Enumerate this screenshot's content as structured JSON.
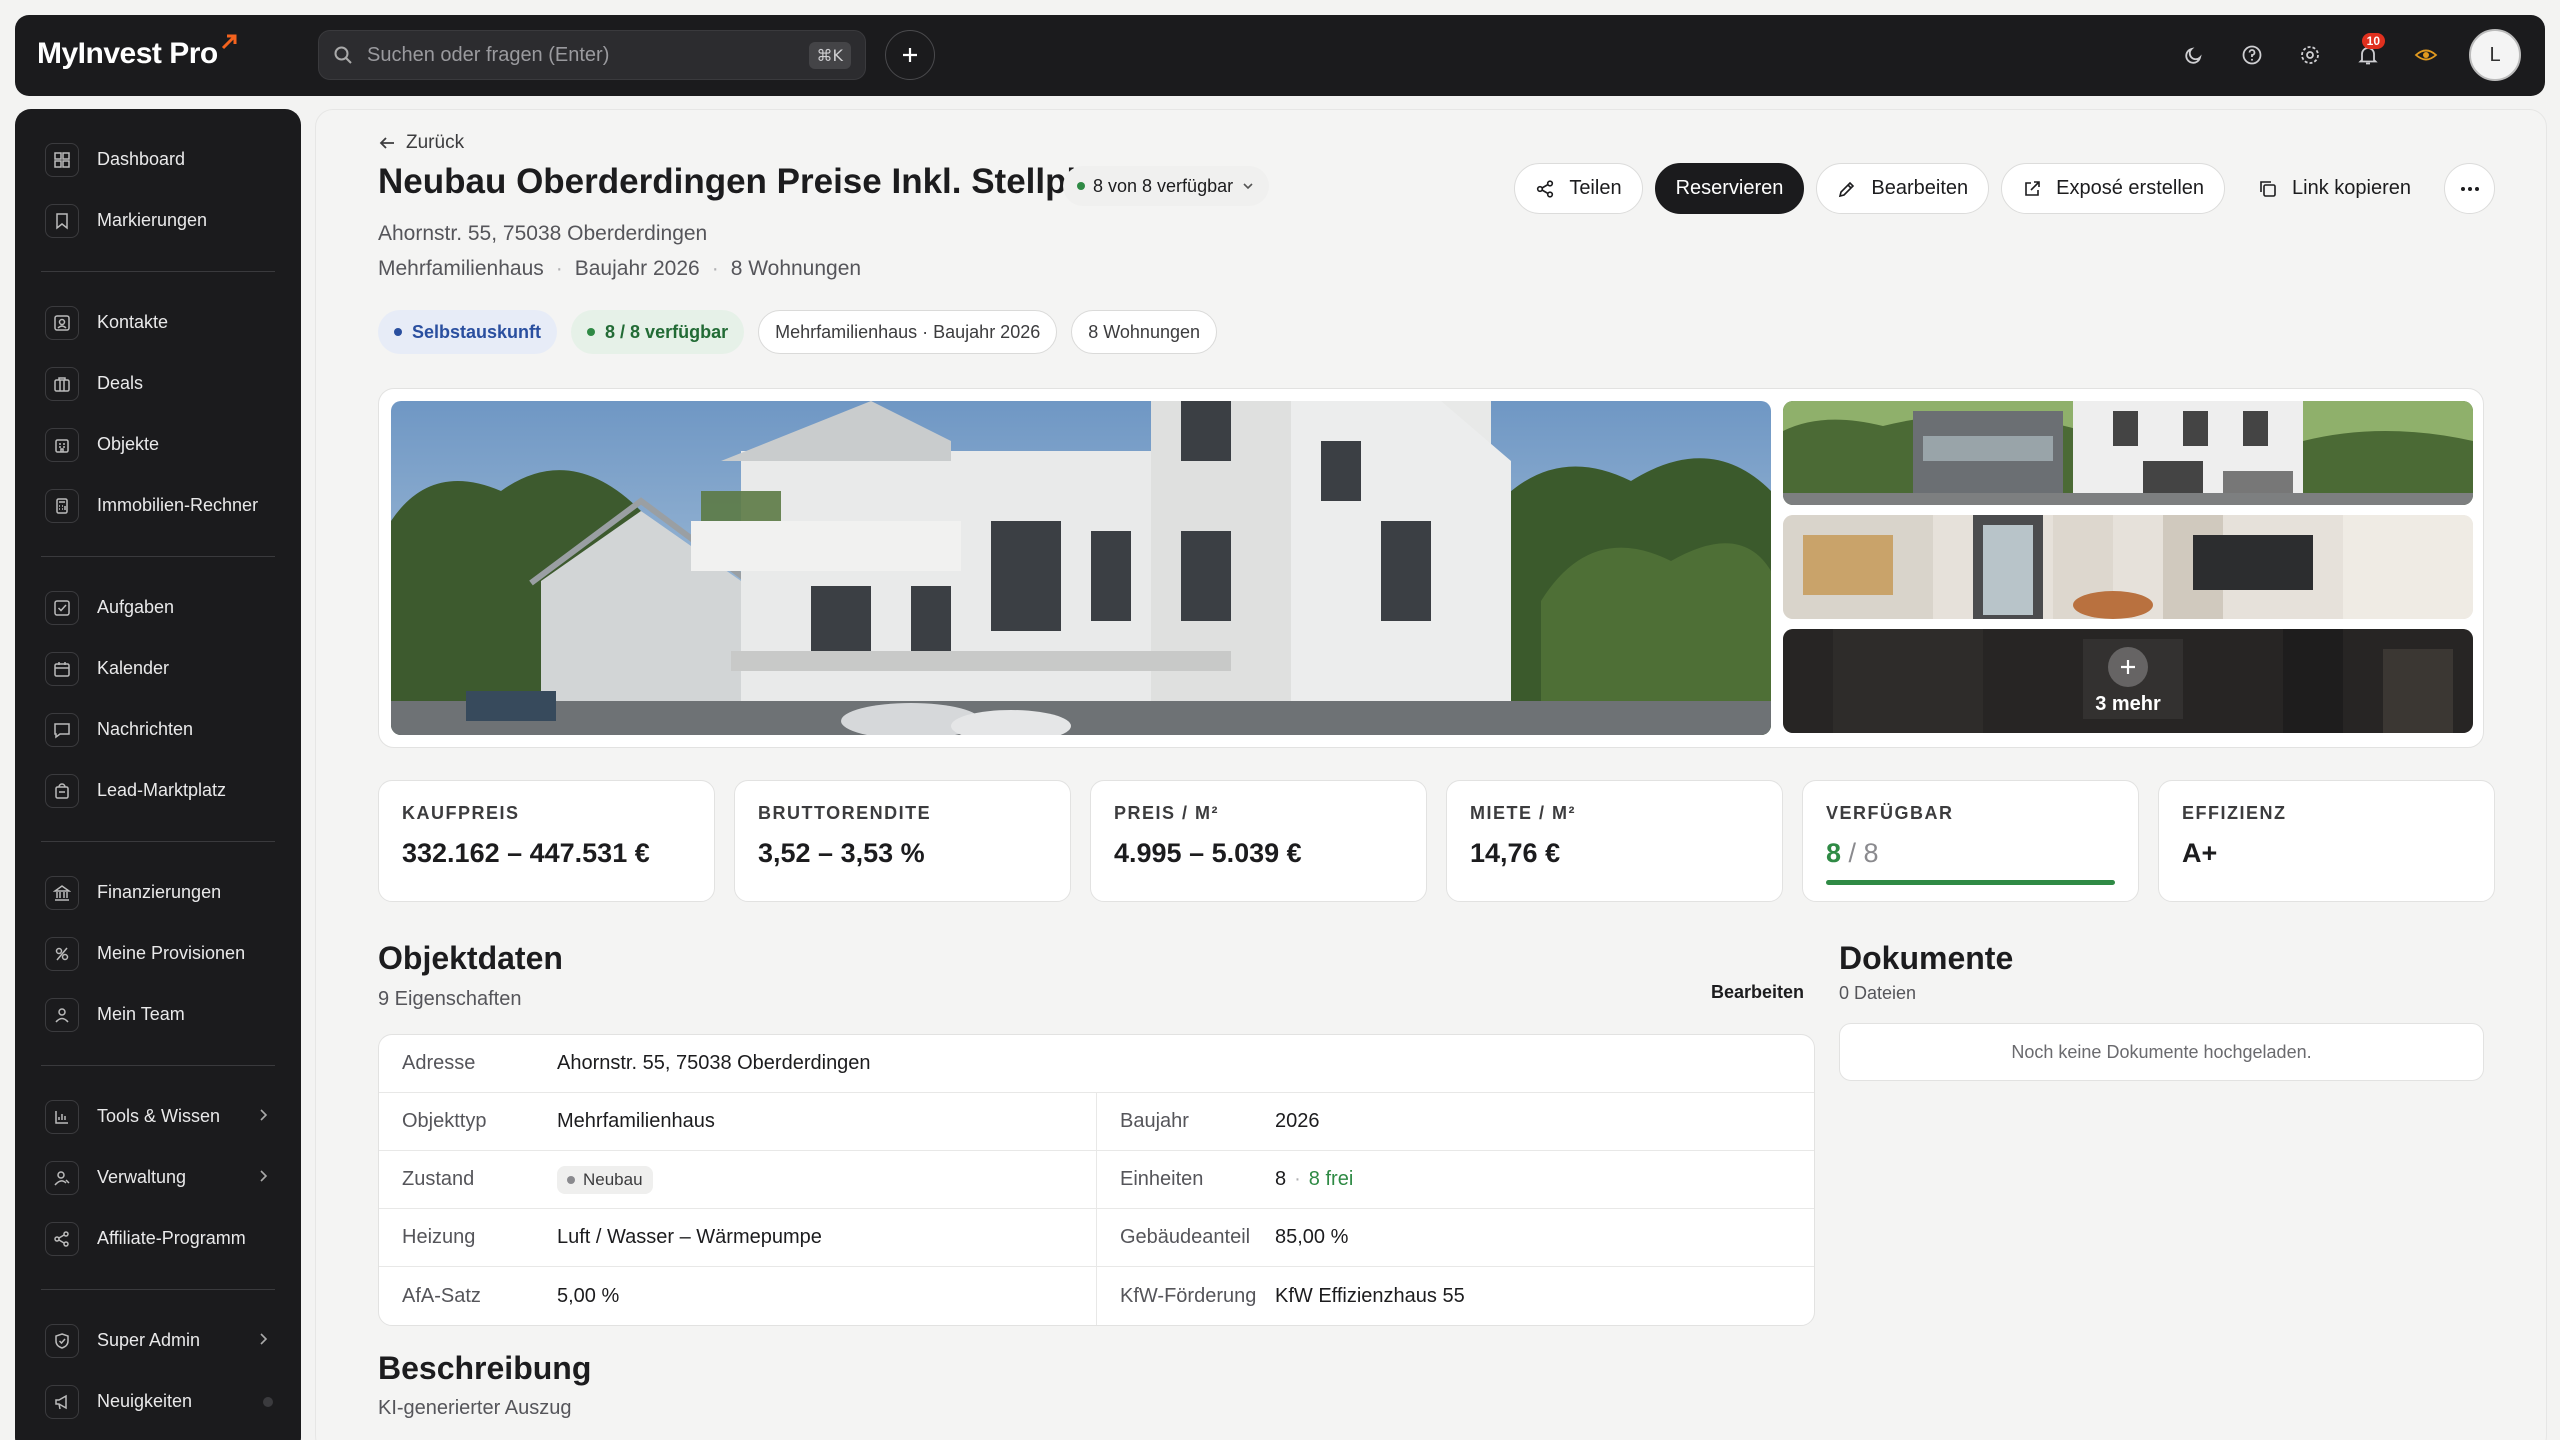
{
  "app": {
    "brand": "MyInvest Pro"
  },
  "search": {
    "placeholder": "Suchen oder fragen (Enter)",
    "shortcut": "⌘K"
  },
  "notifications": {
    "count": "10"
  },
  "user": {
    "initial": "L"
  },
  "sidebar": {
    "group1": [
      {
        "label": "Dashboard",
        "icon": "dashboard-icon"
      },
      {
        "label": "Markierungen",
        "icon": "bookmark-icon"
      }
    ],
    "group2": [
      {
        "label": "Kontakte",
        "icon": "contacts-icon"
      },
      {
        "label": "Deals",
        "icon": "briefcase-icon"
      },
      {
        "label": "Objekte",
        "icon": "building-icon"
      },
      {
        "label": "Immobilien-Rechner",
        "icon": "calculator-icon"
      }
    ],
    "group3": [
      {
        "label": "Aufgaben",
        "icon": "task-icon"
      },
      {
        "label": "Kalender",
        "icon": "calendar-icon"
      },
      {
        "label": "Nachrichten",
        "icon": "message-icon"
      },
      {
        "label": "Lead-Marktplatz",
        "icon": "marketplace-icon"
      }
    ],
    "group4": [
      {
        "label": "Finanzierungen",
        "icon": "bank-icon"
      },
      {
        "label": "Meine Provisionen",
        "icon": "commission-icon"
      },
      {
        "label": "Mein Team",
        "icon": "team-icon"
      }
    ],
    "group5": [
      {
        "label": "Tools & Wissen",
        "icon": "chart-icon"
      },
      {
        "label": "Verwaltung",
        "icon": "admin-user-icon"
      },
      {
        "label": "Affiliate-Programm",
        "icon": "share-icon"
      }
    ],
    "group6": [
      {
        "label": "Super Admin",
        "icon": "shield-icon"
      },
      {
        "label": "Neuigkeiten",
        "icon": "megaphone-icon"
      }
    ]
  },
  "header": {
    "back_label": "Zurück",
    "title": "Neubau Oberderdingen Preise Inkl. Stellplatz",
    "availability": "8 von 8 verfügbar",
    "address": "Ahornstr. 55, 75038 Oberderdingen",
    "meta": [
      "Mehrfamilienhaus",
      "Baujahr 2026",
      "8 Wohnungen"
    ]
  },
  "actions": {
    "share": "Teilen",
    "reserve": "Reservieren",
    "edit": "Bearbeiten",
    "expose": "Exposé erstellen",
    "copy_link": "Link kopieren"
  },
  "chips": {
    "self_info": "Selbstauskunft",
    "available": "8 / 8  verfügbar",
    "type_year": "Mehrfamilienhaus · Baujahr  2026",
    "units": "8 Wohnungen"
  },
  "gallery": {
    "more_label": "3 mehr"
  },
  "kpis": [
    {
      "label": "Kaufpreis",
      "value": "332.162 – 447.531 €"
    },
    {
      "label": "Bruttorendite",
      "value": "3,52 – 3,53 %"
    },
    {
      "label": "Preis / m²",
      "value": "4.995 – 5.039 €"
    },
    {
      "label": "Miete / m²",
      "value": "14,76 €"
    },
    {
      "label": "Verfügbar",
      "available": "8",
      "total": "8",
      "progress": 1.0
    },
    {
      "label": "Effizienz",
      "value": "A+"
    }
  ],
  "objektdaten": {
    "title": "Objektdaten",
    "subtitle": "9 Eigenschaften",
    "edit_label": "Bearbeiten",
    "address_label": "Adresse",
    "address_value": "Ahornstr. 55, 75038 Oberderdingen",
    "rows": [
      {
        "k1": "Objekttyp",
        "v1": "Mehrfamilienhaus",
        "k2": "Baujahr",
        "v2": "2026"
      },
      {
        "k1": "Zustand",
        "v1": "Neubau",
        "k2": "Einheiten",
        "v2": "8",
        "v2b": "8 frei"
      },
      {
        "k1": "Heizung",
        "v1": "Luft / Wasser – Wärmepumpe",
        "k2": "Gebäudeanteil",
        "v2": "85,00 %"
      },
      {
        "k1": "AfA-Satz",
        "v1": "5,00 %",
        "k2": "KfW-Förderung",
        "v2": "KfW Effizienzhaus 55"
      }
    ]
  },
  "dokumente": {
    "title": "Dokumente",
    "subtitle": "0 Dateien",
    "empty": "Noch keine Dokumente hochgeladen."
  },
  "beschreibung": {
    "title": "Beschreibung",
    "subtitle": "KI-generierter Auszug"
  },
  "colors": {
    "accent_green": "#2f8a45",
    "dark": "#1b1b1d",
    "chip_blue": "#2a4f9f",
    "alert_red": "#e0301e",
    "eye_orange": "#e29a1f"
  }
}
